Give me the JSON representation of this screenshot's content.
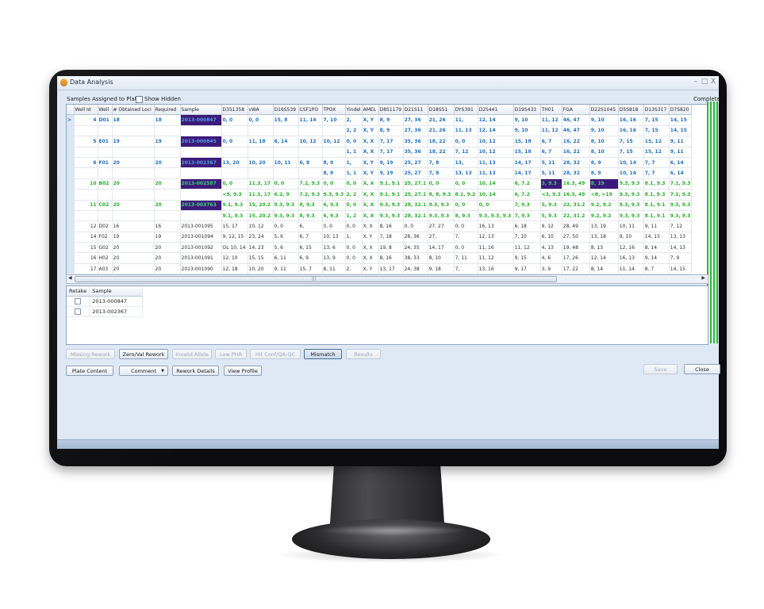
{
  "window": {
    "title": "Data Analysis",
    "minimize": "–",
    "maximize": "□",
    "close": "X"
  },
  "toolbar": {
    "samples_label": "Samples Assigned to Plate",
    "show_hidden_label": "Show Hidden",
    "complete_label": "Complete"
  },
  "grid": {
    "columns": [
      "",
      "Well Id",
      "Well",
      "# Obtained Loci",
      "Required",
      "Sample",
      "D3S1358",
      "vWA",
      "D16S539",
      "CSF1PO",
      "TPOX",
      "Yindel",
      "AMEL",
      "D8S1179",
      "D21S11",
      "D18S51",
      "DYS391",
      "D2S441",
      "D19S433",
      "TH01",
      "FGA",
      "D22S1045",
      "D5S818",
      "D13S317",
      "D7S820"
    ],
    "rows": [
      {
        "style": "blue",
        "indicator": ">",
        "cells": [
          "4",
          "D01",
          "18",
          "18",
          "2013-000847",
          "0, 0",
          "0, 0",
          "15, 8",
          "11, 14",
          "7, 10",
          "2,",
          "X, Y",
          "8, 9",
          "27, 36",
          "21, 26",
          "11,",
          "12, 14",
          "9, 10",
          "11, 12",
          "46, 47",
          "9, 10",
          "16, 16",
          "7, 15",
          "14, 15"
        ]
      },
      {
        "style": "blue",
        "indicator": "",
        "cells": [
          "",
          "",
          "",
          "",
          "",
          "",
          "",
          "",
          "",
          "",
          "2, 2",
          "X, Y",
          "8, 9",
          "27, 36",
          "21, 26",
          "11, 13",
          "12, 14",
          "9, 10",
          "11, 12",
          "46, 47",
          "9, 10",
          "16, 16",
          "7, 15",
          "14, 15"
        ]
      },
      {
        "style": "blue",
        "indicator": "",
        "cells": [
          "5",
          "E01",
          "19",
          "19",
          "2013-000845",
          "0, 0",
          "11, 18",
          "6, 14",
          "10, 12",
          "10, 12",
          "0, 0",
          "X, X",
          "7, 17",
          "35, 36",
          "18, 22",
          "0, 0",
          "10, 12",
          "15, 18",
          "6, 7",
          "16, 22",
          "8, 10",
          "7, 15",
          "15, 12",
          "9, 11"
        ]
      },
      {
        "style": "blue",
        "indicator": "",
        "cells": [
          "",
          "",
          "",
          "",
          "",
          "",
          "",
          "",
          "",
          "",
          "1, 1",
          "X, X",
          "7, 17",
          "35, 36",
          "18, 22",
          "7, 12",
          "10, 12",
          "15, 18",
          "6, 7",
          "16, 22",
          "8, 10",
          "7, 15",
          "15, 12",
          "9, 11"
        ]
      },
      {
        "style": "blue",
        "indicator": "",
        "cells": [
          "6",
          "F01",
          "20",
          "20",
          "2013-002367",
          "13, 20",
          "10, 20",
          "10, 11",
          "6, 8",
          "8, 9",
          "1,",
          "X, Y",
          "9, 19",
          "25, 27",
          "7, 8",
          "13,",
          "11, 13",
          "14, 17",
          "5, 11",
          "28, 32",
          "8, 9",
          "10, 14",
          "7, 7",
          "6, 14"
        ]
      },
      {
        "style": "blue",
        "indicator": "",
        "cells": [
          "",
          "",
          "",
          "",
          "",
          "",
          "",
          "",
          "",
          "8, 9",
          "1, 1",
          "X, Y",
          "9, 19",
          "25, 27",
          "7, 8",
          "13, 13",
          "11, 13",
          "14, 17",
          "5, 11",
          "28, 32",
          "8, 9",
          "10, 14",
          "7, 7",
          "6, 14"
        ]
      },
      {
        "style": "green",
        "indicator": "",
        "cells": [
          "10",
          "B02",
          "20",
          "20",
          "2013-002587",
          "0, 0",
          "11.3, 17",
          "0, 0",
          "7.2, 9.3",
          "0, 0",
          "0, 0",
          "X, X",
          "9.1, 9.1",
          "25, 27.1",
          "0, 0",
          "0, 0",
          "10, 14",
          "6, 7.2",
          "3, 9.3",
          "16.3, 49",
          "8, 19",
          "9.3, 9.3",
          "8.1, 9.3",
          "7.1, 9.3"
        ]
      },
      {
        "style": "green",
        "indicator": "",
        "cells": [
          "",
          "",
          "",
          "",
          "",
          "<9, 9.3",
          "11.3, 17",
          "6.2, 9",
          "7.2, 9.3",
          "9.3, 9.3",
          "2, 2",
          "X, X",
          "9.1, 9.1",
          "25, 27.1",
          "8, 8, 9.3",
          "8.1, 9.2",
          "10, 14",
          "6, 7.2",
          "<3, 9.3",
          "16.3, 49",
          "<8, >19",
          "9.3, 9.3",
          "8.1, 9.3",
          "7.1, 9.3"
        ]
      },
      {
        "style": "green",
        "indicator": "",
        "cells": [
          "11",
          "C02",
          "20",
          "20",
          "2013-003763",
          "9.1, 9.3",
          "15, 20.2",
          "9.3, 9.3",
          "8, 9.3",
          "6, 9.3",
          "0, 0",
          "X, X",
          "9.3, 9.3",
          "28, 32.1",
          "9.3, 9.3",
          "0, 0",
          "0, 0",
          "7, 9.3",
          "5, 9.3",
          "22, 31.2",
          "9.2, 9.2",
          "9.3, 9.3",
          "8.1, 9.1",
          "9.3, 9.3"
        ]
      },
      {
        "style": "green",
        "indicator": "",
        "cells": [
          "",
          "",
          "",
          "",
          "",
          "9.1, 9.3",
          "15, 20.2",
          "9.3, 9.3",
          "8, 9.3",
          "6, 9.3",
          "1, 2",
          "X, X",
          "9.3, 9.3",
          "28, 32.1",
          "9.3, 9.3",
          "8, 9.3",
          "9.3, 9.3, 9.3",
          "7, 9.3",
          "5, 9.3",
          "22, 31.2",
          "9.2, 9.2",
          "9.3, 9.3",
          "8.1, 9.1",
          "9.3, 9.3"
        ]
      },
      {
        "style": "plain",
        "indicator": "",
        "cells": [
          "12",
          "D02",
          "16",
          "16",
          "2013-001095",
          "15, 17",
          "10, 12",
          "0, 0",
          "6,",
          "0, 0",
          "0, 0",
          "X, X",
          "8, 16",
          "0, 0",
          "27, 27",
          "0, 0",
          "16, 13",
          "6, 18",
          "9, 12",
          "28, 49",
          "13, 19",
          "10, 11",
          "9, 11",
          "7, 12"
        ]
      },
      {
        "style": "plain",
        "indicator": "",
        "cells": [
          "14",
          "F02",
          "19",
          "19",
          "2013-001094",
          "9, 12, 15",
          "23, 24",
          "5, 6",
          "6, 7",
          "10, 13",
          "1,",
          "X, Y",
          "7, 18",
          "28, 36",
          "27,",
          "7,",
          "12, 13",
          "7, 10",
          "6, 10",
          "27, 50",
          "13, 18",
          "9, 10",
          "14, 15",
          "13, 13"
        ]
      },
      {
        "style": "plain",
        "indicator": "",
        "cells": [
          "15",
          "G02",
          "20",
          "20",
          "2013-001092",
          "OL 10, 14",
          "14, 23",
          "5, 6",
          "6, 15",
          "13, 6",
          "0, 0",
          "X, X",
          "19, 8",
          "24, 35",
          "14, 17",
          "0, 0",
          "11, 16",
          "11, 12",
          "4, 13",
          "19, 48",
          "8, 13",
          "12, 16",
          "8, 14",
          "14, 13"
        ]
      },
      {
        "style": "plain",
        "indicator": "",
        "cells": [
          "16",
          "H02",
          "20",
          "20",
          "2013-001091",
          "12, 10",
          "15, 15",
          "6, 11",
          "6, 9",
          "13, 9",
          "0, 0",
          "X, X",
          "8, 16",
          "38, 33",
          "8, 10",
          "7, 11",
          "11, 12",
          "9, 15",
          "4, 6",
          "17, 26",
          "12, 14",
          "16, 13",
          "9, 14",
          "7, 9"
        ]
      },
      {
        "style": "plain",
        "indicator": "",
        "cells": [
          "17",
          "A03",
          "20",
          "20",
          "2013-001090",
          "12, 18",
          "10, 20",
          "9, 11",
          "15, 7",
          "8, 11",
          "2,",
          "X, Y",
          "13, 17",
          "24, 38",
          "9, 18",
          "7,",
          "13, 16",
          "9, 17",
          "3, 9",
          "17, 22",
          "8, 14",
          "11, 14",
          "8, 7",
          "14, 15"
        ]
      }
    ]
  },
  "retake": {
    "columns": [
      "Retake",
      "Sample"
    ],
    "rows": [
      {
        "sample": "2013-000847"
      },
      {
        "sample": "2013-002367"
      }
    ]
  },
  "filter_buttons": [
    "Missing Rework",
    "Zero/Val Rework",
    "Invalid Allele",
    "Low PHR",
    "Hit Conf/QA-QC",
    "Mismatch",
    "Results"
  ],
  "action_buttons": {
    "plate_content": "Plate Content",
    "comment": "Comment",
    "rework_details": "Rework Details",
    "view_profile": "View Profile",
    "save": "Save",
    "close": "Close"
  }
}
